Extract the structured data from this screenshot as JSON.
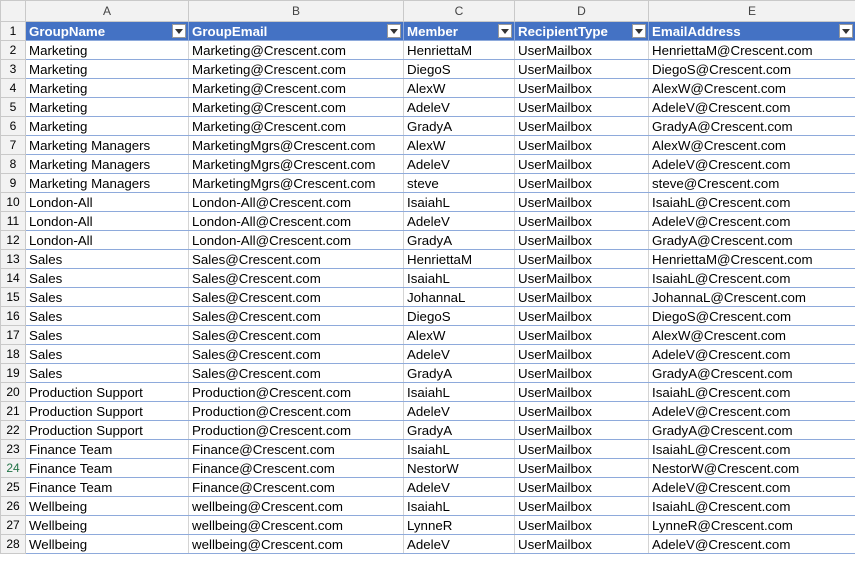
{
  "columns": [
    "A",
    "B",
    "C",
    "D",
    "E"
  ],
  "headers": [
    "GroupName",
    "GroupEmail",
    "Member",
    "RecipientType",
    "EmailAddress"
  ],
  "header_row_number": "1",
  "accent_color": "#4472c4",
  "rows": [
    {
      "num": "2",
      "cells": [
        "Marketing",
        "Marketing@Crescent.com",
        "HenriettaM",
        "UserMailbox",
        "HenriettaM@Crescent.com"
      ]
    },
    {
      "num": "3",
      "cells": [
        "Marketing",
        "Marketing@Crescent.com",
        "DiegoS",
        "UserMailbox",
        "DiegoS@Crescent.com"
      ]
    },
    {
      "num": "4",
      "cells": [
        "Marketing",
        "Marketing@Crescent.com",
        "AlexW",
        "UserMailbox",
        "AlexW@Crescent.com"
      ]
    },
    {
      "num": "5",
      "cells": [
        "Marketing",
        "Marketing@Crescent.com",
        "AdeleV",
        "UserMailbox",
        "AdeleV@Crescent.com"
      ]
    },
    {
      "num": "6",
      "cells": [
        "Marketing",
        "Marketing@Crescent.com",
        "GradyA",
        "UserMailbox",
        "GradyA@Crescent.com"
      ]
    },
    {
      "num": "7",
      "cells": [
        "Marketing Managers",
        "MarketingMgrs@Crescent.com",
        "AlexW",
        "UserMailbox",
        "AlexW@Crescent.com"
      ]
    },
    {
      "num": "8",
      "cells": [
        "Marketing Managers",
        "MarketingMgrs@Crescent.com",
        "AdeleV",
        "UserMailbox",
        "AdeleV@Crescent.com"
      ]
    },
    {
      "num": "9",
      "cells": [
        "Marketing Managers",
        "MarketingMgrs@Crescent.com",
        "steve",
        "UserMailbox",
        "steve@Crescent.com"
      ]
    },
    {
      "num": "10",
      "cells": [
        "London-All",
        "London-All@Crescent.com",
        "IsaiahL",
        "UserMailbox",
        "IsaiahL@Crescent.com"
      ]
    },
    {
      "num": "11",
      "cells": [
        "London-All",
        "London-All@Crescent.com",
        "AdeleV",
        "UserMailbox",
        "AdeleV@Crescent.com"
      ]
    },
    {
      "num": "12",
      "cells": [
        "London-All",
        "London-All@Crescent.com",
        "GradyA",
        "UserMailbox",
        "GradyA@Crescent.com"
      ]
    },
    {
      "num": "13",
      "cells": [
        "Sales",
        "Sales@Crescent.com",
        "HenriettaM",
        "UserMailbox",
        "HenriettaM@Crescent.com"
      ]
    },
    {
      "num": "14",
      "cells": [
        "Sales",
        "Sales@Crescent.com",
        "IsaiahL",
        "UserMailbox",
        "IsaiahL@Crescent.com"
      ]
    },
    {
      "num": "15",
      "cells": [
        "Sales",
        "Sales@Crescent.com",
        "JohannaL",
        "UserMailbox",
        "JohannaL@Crescent.com"
      ]
    },
    {
      "num": "16",
      "cells": [
        "Sales",
        "Sales@Crescent.com",
        "DiegoS",
        "UserMailbox",
        "DiegoS@Crescent.com"
      ]
    },
    {
      "num": "17",
      "cells": [
        "Sales",
        "Sales@Crescent.com",
        "AlexW",
        "UserMailbox",
        "AlexW@Crescent.com"
      ]
    },
    {
      "num": "18",
      "cells": [
        "Sales",
        "Sales@Crescent.com",
        "AdeleV",
        "UserMailbox",
        "AdeleV@Crescent.com"
      ]
    },
    {
      "num": "19",
      "cells": [
        "Sales",
        "Sales@Crescent.com",
        "GradyA",
        "UserMailbox",
        "GradyA@Crescent.com"
      ]
    },
    {
      "num": "20",
      "cells": [
        "Production Support",
        "Production@Crescent.com",
        "IsaiahL",
        "UserMailbox",
        "IsaiahL@Crescent.com"
      ]
    },
    {
      "num": "21",
      "cells": [
        "Production Support",
        "Production@Crescent.com",
        "AdeleV",
        "UserMailbox",
        "AdeleV@Crescent.com"
      ]
    },
    {
      "num": "22",
      "cells": [
        "Production Support",
        "Production@Crescent.com",
        "GradyA",
        "UserMailbox",
        "GradyA@Crescent.com"
      ]
    },
    {
      "num": "23",
      "cells": [
        "Finance Team",
        "Finance@Crescent.com",
        "IsaiahL",
        "UserMailbox",
        "IsaiahL@Crescent.com"
      ]
    },
    {
      "num": "24",
      "cells": [
        "Finance Team",
        "Finance@Crescent.com",
        "NestorW",
        "UserMailbox",
        "NestorW@Crescent.com"
      ]
    },
    {
      "num": "25",
      "cells": [
        "Finance Team",
        "Finance@Crescent.com",
        "AdeleV",
        "UserMailbox",
        "AdeleV@Crescent.com"
      ]
    },
    {
      "num": "26",
      "cells": [
        "Wellbeing",
        "wellbeing@Crescent.com",
        "IsaiahL",
        "UserMailbox",
        "IsaiahL@Crescent.com"
      ]
    },
    {
      "num": "27",
      "cells": [
        "Wellbeing",
        "wellbeing@Crescent.com",
        "LynneR",
        "UserMailbox",
        "LynneR@Crescent.com"
      ]
    },
    {
      "num": "28",
      "cells": [
        "Wellbeing",
        "wellbeing@Crescent.com",
        "AdeleV",
        "UserMailbox",
        "AdeleV@Crescent.com"
      ]
    }
  ],
  "active_row": "24"
}
